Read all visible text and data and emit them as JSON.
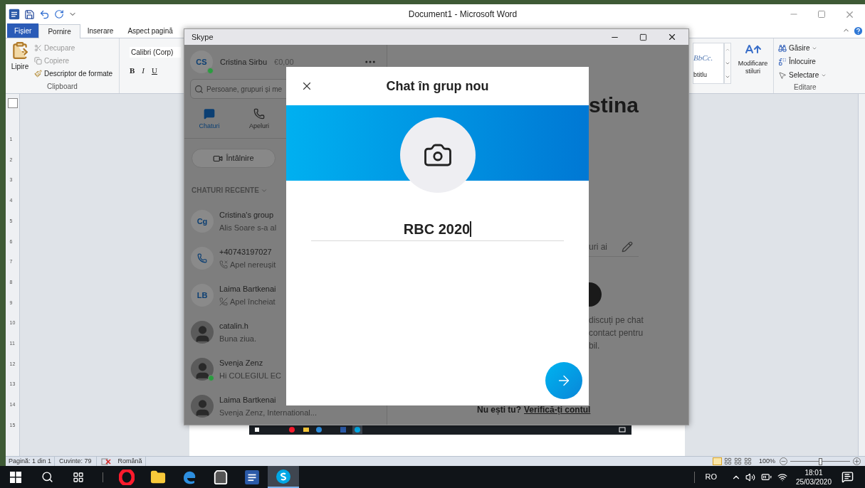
{
  "word": {
    "title": "Document1 - Microsoft Word",
    "tabs": [
      {
        "label": "Fișier",
        "kind": "file",
        "selected": false
      },
      {
        "label": "Pornire",
        "kind": "tab",
        "selected": true
      },
      {
        "label": "Inserare",
        "kind": "tab",
        "selected": false
      },
      {
        "label": "Aspect pagină",
        "kind": "tab",
        "selected": false
      }
    ],
    "clipboard": {
      "paste": "Lipire",
      "cut": "Decupare",
      "copy": "Copiere",
      "painter": "Descriptor de formate",
      "group": "Clipboard"
    },
    "font": {
      "name": "Calibri (Corp)",
      "bold": "B",
      "italic": "I",
      "underline": "U"
    },
    "styles": {
      "preview": "BbCc.",
      "name": "btitlu",
      "change": "Modificare stiluri"
    },
    "editing": {
      "find": "Găsire",
      "replace": "Înlocuire",
      "select": "Selectare",
      "group": "Editare"
    },
    "ruler_numbers": [
      "1",
      "2",
      "3",
      "4",
      "5",
      "6",
      "7",
      "8",
      "9",
      "10",
      "11",
      "12",
      "13",
      "14",
      "15"
    ],
    "status_bar": {
      "page": "Pagină: 1 din 1",
      "words": "Cuvinte: 79",
      "language": "Română",
      "zoom": "100%",
      "zoom_slider": {
        "level": 0.5
      }
    }
  },
  "skype": {
    "title": "Skype",
    "profile": {
      "initials": "CS",
      "name": "Cristina Sirbu",
      "credit": "€0,00",
      "online": true
    },
    "search": {
      "placeholder": "Persoane, grupuri și me"
    },
    "nav": [
      {
        "label": "Chaturi",
        "kind": "chats",
        "selected": true
      },
      {
        "label": "Apeluri",
        "kind": "calls",
        "selected": false
      }
    ],
    "meeting_button": "Întâlnire",
    "recent_header": "CHATURI RECENTE",
    "chats": [
      {
        "kind": "initials",
        "initials": "Cg",
        "name": "Cristina's group",
        "preview": "Alis Soare s-a al",
        "online": false
      },
      {
        "kind": "phone",
        "name": "+40743197027",
        "preview": "Apel nereușit",
        "preview_icon": {
          "kind": "missed-call"
        },
        "online": false
      },
      {
        "kind": "initials",
        "initials": "LB",
        "name": "Laima Bartkenai",
        "preview": "Apel încheiat",
        "preview_icon": {
          "kind": "ended-call"
        },
        "online": false
      },
      {
        "kind": "photo",
        "name": "catalin.h",
        "preview": "Buna ziua.",
        "online": false
      },
      {
        "kind": "photo",
        "name": "Svenja Zenz",
        "preview": "Hi COLEGIUL EC",
        "online": true
      },
      {
        "kind": "photo",
        "name": "Laima Bartkenai",
        "preview": "Svenja Zenz, International...",
        "online": false
      }
    ],
    "main": {
      "heading": "stina",
      "field_fragment": "uri ai",
      "text_lines": [
        "discuți pe chat",
        "contact pentru",
        "bil."
      ],
      "footer_question": "Nu ești tu?",
      "footer_link": "Verifică-ți contul"
    },
    "dialog": {
      "title": "Chat în grup nou",
      "name_value": "RBC 2020"
    }
  },
  "taskbar": {
    "apps": [
      {
        "kind": "opera",
        "selected": false
      },
      {
        "kind": "files",
        "selected": false
      },
      {
        "kind": "edge",
        "selected": false
      },
      {
        "kind": "store",
        "selected": false
      },
      {
        "kind": "word",
        "selected": false
      },
      {
        "kind": "skype",
        "selected": true
      }
    ],
    "language": "RO",
    "time": "18:01",
    "date": "25/03/2020"
  }
}
